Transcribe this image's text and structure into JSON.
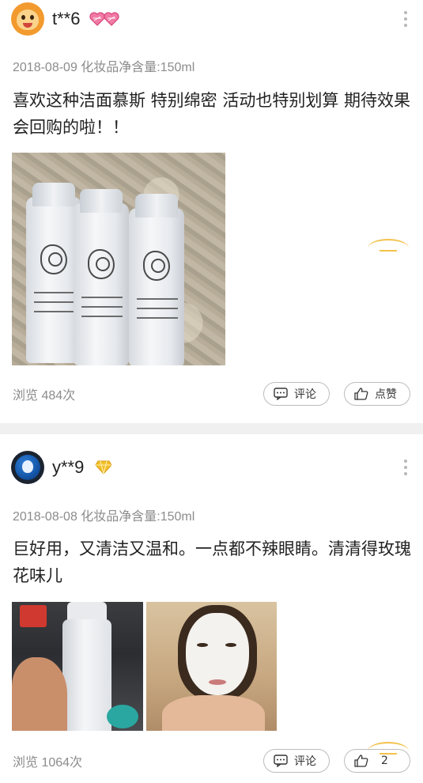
{
  "reviews": [
    {
      "username": "t**6",
      "badge": "heart-badge",
      "meta": "2018-08-09 化妆品净含量:150ml",
      "content": "喜欢这种洁面慕斯 特别绵密 活动也特别划算 期待效果 会回购的啦！！",
      "views": "浏览 484次",
      "comment_label": "评论",
      "like_label": "点赞"
    },
    {
      "username": "y**9",
      "badge": "diamond-badge",
      "meta": "2018-08-08 化妆品净含量:150ml",
      "content": "巨好用，又清洁又温和。一点都不辣眼睛。清清得玫瑰花味儿",
      "views": "浏览 1064次",
      "comment_label": "评论",
      "like_label": "2"
    }
  ],
  "colors": {
    "badge_pink": "#e8578a",
    "badge_gold": "#f4c02b",
    "loader_gold": "#f3c24a",
    "meta_gray": "#8c8c8c"
  }
}
